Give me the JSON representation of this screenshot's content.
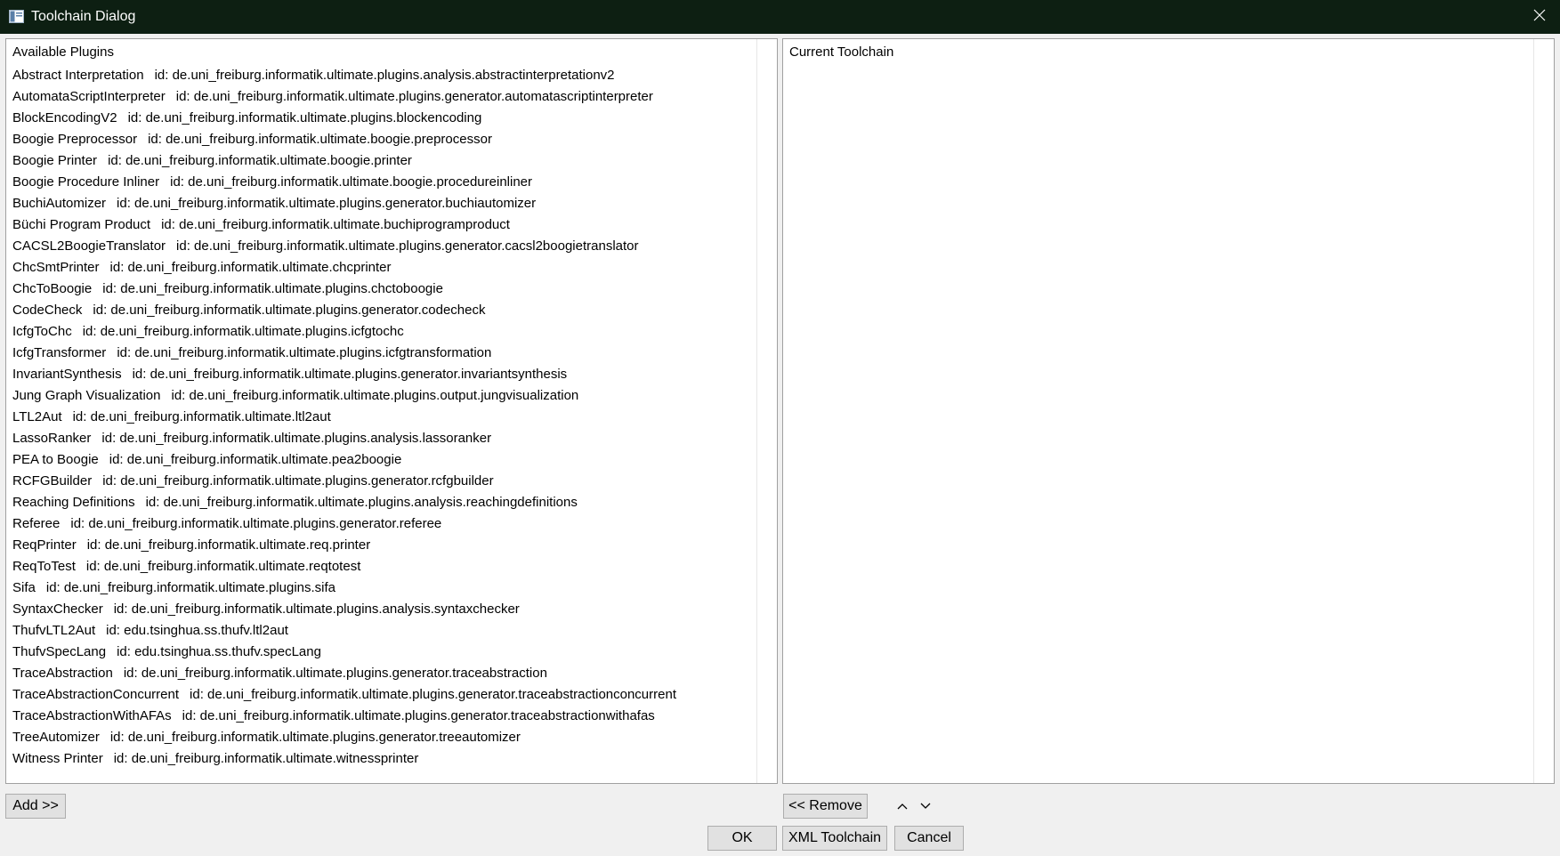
{
  "window": {
    "title": "Toolchain Dialog",
    "icons": {
      "app": "window-app-icon",
      "close": "close-icon"
    },
    "colors": {
      "titlebar": "#0d1f12",
      "background": "#f0f0f0"
    }
  },
  "available": {
    "header": "Available Plugins",
    "plugins": [
      {
        "name": "Abstract Interpretation",
        "id": "id: de.uni_freiburg.informatik.ultimate.plugins.analysis.abstractinterpretationv2"
      },
      {
        "name": "AutomataScriptInterpreter",
        "id": "id: de.uni_freiburg.informatik.ultimate.plugins.generator.automatascriptinterpreter"
      },
      {
        "name": "BlockEncodingV2",
        "id": "id: de.uni_freiburg.informatik.ultimate.plugins.blockencoding"
      },
      {
        "name": "Boogie Preprocessor",
        "id": "id: de.uni_freiburg.informatik.ultimate.boogie.preprocessor"
      },
      {
        "name": "Boogie Printer",
        "id": "id: de.uni_freiburg.informatik.ultimate.boogie.printer"
      },
      {
        "name": "Boogie Procedure Inliner",
        "id": "id: de.uni_freiburg.informatik.ultimate.boogie.procedureinliner"
      },
      {
        "name": "BuchiAutomizer",
        "id": "id: de.uni_freiburg.informatik.ultimate.plugins.generator.buchiautomizer"
      },
      {
        "name": "Büchi Program Product",
        "id": "id: de.uni_freiburg.informatik.ultimate.buchiprogramproduct"
      },
      {
        "name": "CACSL2BoogieTranslator",
        "id": "id: de.uni_freiburg.informatik.ultimate.plugins.generator.cacsl2boogietranslator"
      },
      {
        "name": "ChcSmtPrinter",
        "id": "id: de.uni_freiburg.informatik.ultimate.chcprinter"
      },
      {
        "name": "ChcToBoogie",
        "id": "id: de.uni_freiburg.informatik.ultimate.plugins.chctoboogie"
      },
      {
        "name": "CodeCheck",
        "id": "id: de.uni_freiburg.informatik.ultimate.plugins.generator.codecheck"
      },
      {
        "name": "IcfgToChc",
        "id": "id: de.uni_freiburg.informatik.ultimate.plugins.icfgtochc"
      },
      {
        "name": "IcfgTransformer",
        "id": "id: de.uni_freiburg.informatik.ultimate.plugins.icfgtransformation"
      },
      {
        "name": "InvariantSynthesis",
        "id": "id: de.uni_freiburg.informatik.ultimate.plugins.generator.invariantsynthesis"
      },
      {
        "name": "Jung Graph Visualization",
        "id": "id: de.uni_freiburg.informatik.ultimate.plugins.output.jungvisualization"
      },
      {
        "name": "LTL2Aut",
        "id": "id: de.uni_freiburg.informatik.ultimate.ltl2aut"
      },
      {
        "name": "LassoRanker",
        "id": "id: de.uni_freiburg.informatik.ultimate.plugins.analysis.lassoranker"
      },
      {
        "name": "PEA to Boogie",
        "id": "id: de.uni_freiburg.informatik.ultimate.pea2boogie"
      },
      {
        "name": "RCFGBuilder",
        "id": "id: de.uni_freiburg.informatik.ultimate.plugins.generator.rcfgbuilder"
      },
      {
        "name": "Reaching Definitions",
        "id": "id: de.uni_freiburg.informatik.ultimate.plugins.analysis.reachingdefinitions"
      },
      {
        "name": "Referee",
        "id": "id: de.uni_freiburg.informatik.ultimate.plugins.generator.referee"
      },
      {
        "name": "ReqPrinter",
        "id": "id: de.uni_freiburg.informatik.ultimate.req.printer"
      },
      {
        "name": "ReqToTest",
        "id": "id: de.uni_freiburg.informatik.ultimate.reqtotest"
      },
      {
        "name": "Sifa",
        "id": "id: de.uni_freiburg.informatik.ultimate.plugins.sifa"
      },
      {
        "name": "SyntaxChecker",
        "id": "id: de.uni_freiburg.informatik.ultimate.plugins.analysis.syntaxchecker"
      },
      {
        "name": "ThufvLTL2Aut",
        "id": "id: edu.tsinghua.ss.thufv.ltl2aut"
      },
      {
        "name": "ThufvSpecLang",
        "id": "id: edu.tsinghua.ss.thufv.specLang"
      },
      {
        "name": "TraceAbstraction",
        "id": "id: de.uni_freiburg.informatik.ultimate.plugins.generator.traceabstraction"
      },
      {
        "name": "TraceAbstractionConcurrent",
        "id": "id: de.uni_freiburg.informatik.ultimate.plugins.generator.traceabstractionconcurrent"
      },
      {
        "name": "TraceAbstractionWithAFAs",
        "id": "id: de.uni_freiburg.informatik.ultimate.plugins.generator.traceabstractionwithafas"
      },
      {
        "name": "TreeAutomizer",
        "id": "id: de.uni_freiburg.informatik.ultimate.plugins.generator.treeautomizer"
      },
      {
        "name": "Witness Printer",
        "id": "id: de.uni_freiburg.informatik.ultimate.witnessprinter"
      }
    ]
  },
  "current": {
    "header": "Current Toolchain",
    "plugins": []
  },
  "buttons": {
    "add": "Add >>",
    "remove": "<< Remove",
    "ok": "OK",
    "xml": "XML Toolchain",
    "cancel": "Cancel"
  },
  "arrows": {
    "up": "chevron-up-icon",
    "down": "chevron-down-icon"
  }
}
